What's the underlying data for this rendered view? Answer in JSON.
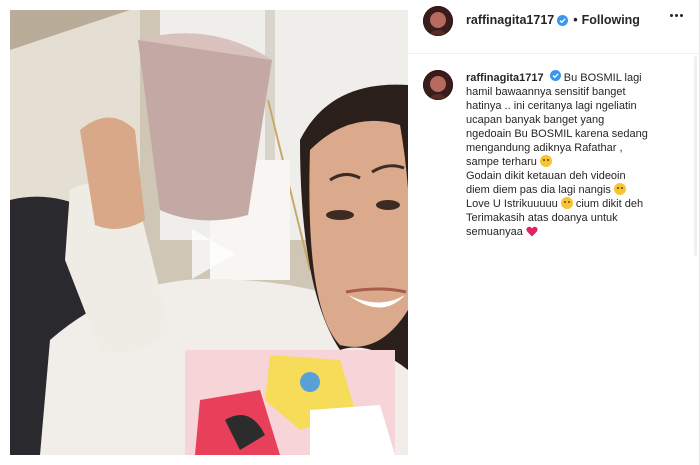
{
  "post": {
    "username": "raffinagita1717",
    "separator": "•",
    "follow_status": "Following"
  },
  "caption": {
    "username": "raffinagita1717",
    "lines": [
      "Bu BOSMIL lagi",
      "hamil bawaannya sensitif banget",
      "hatinya .. ini ceritanya lagi ngeliatin",
      "ucapan banyak banget yang",
      "ngedoain Bu BOSMIL karena sedang",
      "mengandung adiknya Rafathar ,",
      "sampe terharu",
      "Godain dikit ketauan deh videoin",
      "diem diem pas dia lagi nangis",
      "Love U Istrikuuuuu",
      "cium dikit deh",
      "Terimakasih atas doanya untuk",
      "semuanyaa"
    ]
  },
  "colors": {
    "verified": "#3897f0",
    "heart": "#e0245e",
    "emoji": "#f6c433"
  },
  "icons": {
    "verified": "verified-badge-icon",
    "more": "more-options-icon",
    "play": "play-icon"
  }
}
